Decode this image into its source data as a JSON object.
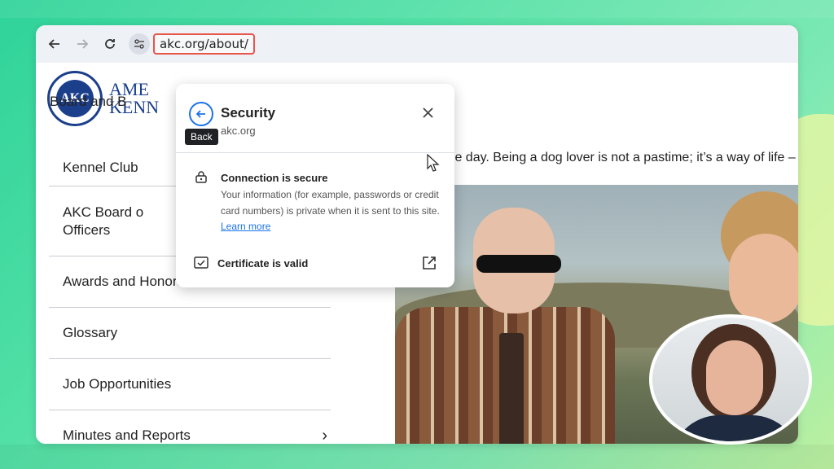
{
  "browser": {
    "url": "akc.org/about/",
    "back_icon": "arrow-left-icon",
    "forward_icon": "arrow-right-icon",
    "reload_icon": "reload-icon",
    "site_info_icon": "tune-icon",
    "url_highlight_color": "#e8554a"
  },
  "page": {
    "logo_short": "AKC",
    "logo_text_line1": "AME",
    "logo_text_line2": "KENN",
    "partial_top_line": "Board and B",
    "body_text": "gle day. Being a dog lover is not a pastime; it’s a way of life – and w",
    "sidebar": [
      {
        "label": "Kennel Club",
        "chevron": false
      },
      {
        "label": "AKC Board of Directors and Officers",
        "line1": "AKC Board o",
        "line2": "Officers",
        "chevron": false
      },
      {
        "label": "Awards and Honors",
        "chevron": true
      },
      {
        "label": "Glossary",
        "chevron": false
      },
      {
        "label": "Job Opportunities",
        "chevron": false
      },
      {
        "label": "Minutes and Reports",
        "chevron": true
      }
    ]
  },
  "popup": {
    "title": "Security",
    "domain": "akc.org",
    "close_icon": "close-icon",
    "back_tooltip": "Back",
    "connection_title": "Connection is secure",
    "connection_desc": "Your information (for example, passwords or credit card numbers) is private when it is sent to this site.",
    "learn_more": "Learn more",
    "certificate": "Certificate is valid"
  },
  "colors": {
    "accent": "#1a73e8",
    "akc_blue": "#1b3f8b"
  }
}
